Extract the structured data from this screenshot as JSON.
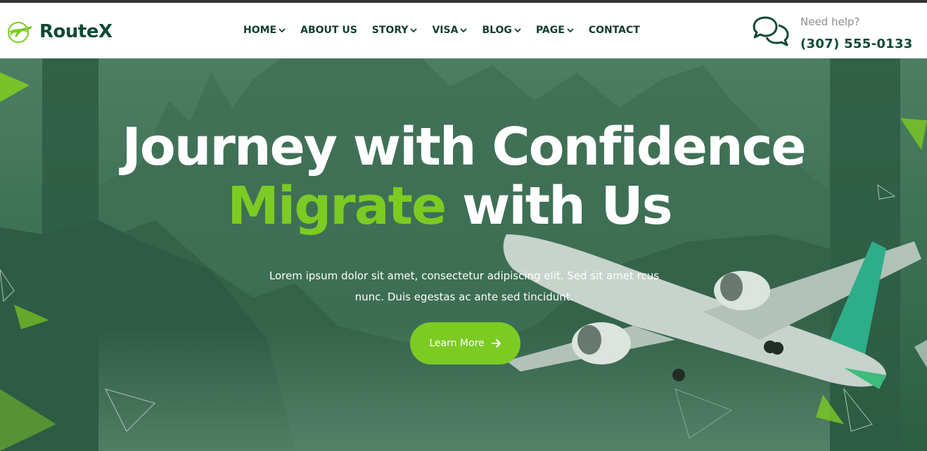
{
  "brand": {
    "name": "RouteX",
    "logo_icon": "plane-globe-icon",
    "color": "#0f4a33",
    "accent": "#7ccb23"
  },
  "nav": {
    "items": [
      {
        "label": "HOME",
        "dropdown": true
      },
      {
        "label": "ABOUT US",
        "dropdown": false
      },
      {
        "label": "STORY",
        "dropdown": true
      },
      {
        "label": "VISA",
        "dropdown": true
      },
      {
        "label": "BLOG",
        "dropdown": true
      },
      {
        "label": "PAGE",
        "dropdown": true
      },
      {
        "label": "CONTACT",
        "dropdown": false
      }
    ]
  },
  "help": {
    "icon": "chat-bubbles-icon",
    "label": "Need help?",
    "phone": "(307) 555-0133"
  },
  "hero": {
    "title_line1": "Journey with Confidence",
    "title_accent": "Migrate",
    "title_line2_rest": " with Us",
    "description": "Lorem ipsum dolor sit amet, consectetur adipiscing elit. Sed sit amet rcus nunc. Duis egestas ac ante sed tincidunt.",
    "cta_label": "Learn More",
    "cta_icon": "arrow-right-icon",
    "overlay_color": "#2f6a4b"
  }
}
